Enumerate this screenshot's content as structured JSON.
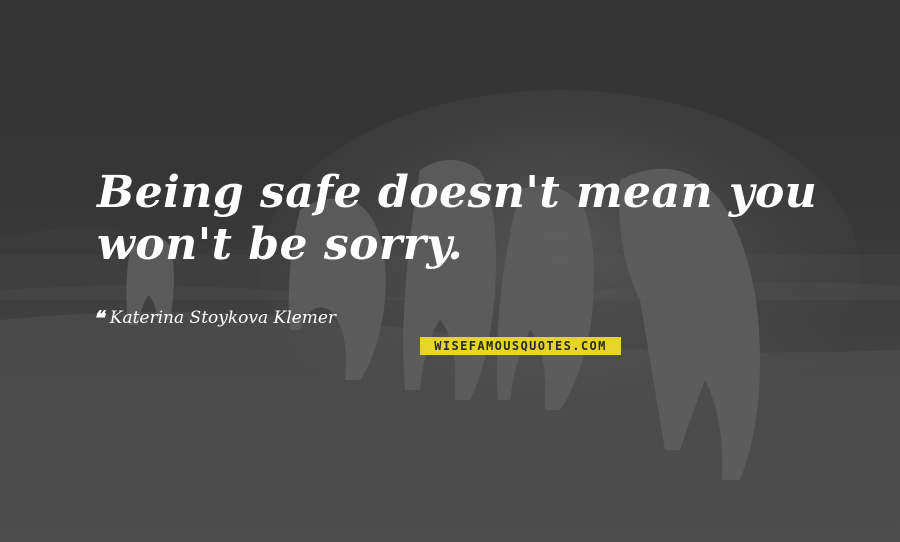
{
  "quote": {
    "text": "Being safe doesn't mean you won't be sorry.",
    "author": "Katerina Stoykova Klemer",
    "quote_mark": "❝"
  },
  "watermark": {
    "text": "WISEFAMOUSQUOTES.COM",
    "background": "#e5d52b"
  },
  "scene": {
    "description_icon": "running-horses-photo"
  }
}
